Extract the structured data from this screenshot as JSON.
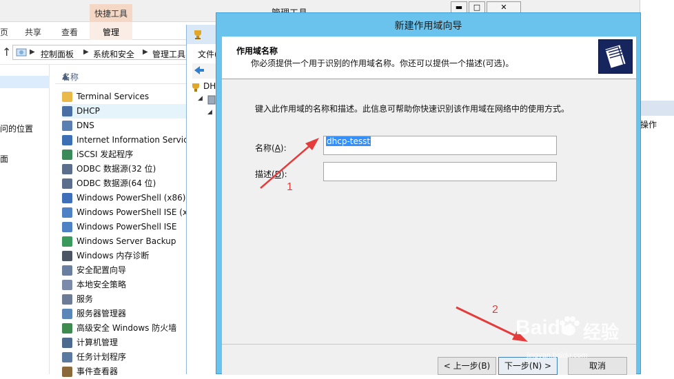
{
  "explorer": {
    "title": "管理工具",
    "context_tab_header": "快捷工具",
    "window_controls": [
      "▬",
      "□",
      "✕"
    ],
    "ribbon_tabs": [
      "页",
      "共享",
      "查看",
      "管理"
    ],
    "breadcrumb": [
      "控制面板",
      "系统和安全",
      "管理工具"
    ],
    "nav_items": [
      "问的位置",
      "面"
    ],
    "column_header": "名称",
    "items": [
      {
        "label": "Terminal Services",
        "icon": "folder-icon",
        "color": "#e9b94a"
      },
      {
        "label": "DHCP",
        "icon": "dhcp-icon",
        "color": "#4a6fa5",
        "selected": true
      },
      {
        "label": "DNS",
        "icon": "dns-icon",
        "color": "#5a7fb0"
      },
      {
        "label": "Internet Information Services",
        "icon": "iis-icon",
        "color": "#3c6fb3"
      },
      {
        "label": "iSCSI 发起程序",
        "icon": "iscsi-icon",
        "color": "#3a8a5a"
      },
      {
        "label": "ODBC 数据源(32 位)",
        "icon": "odbc-icon",
        "color": "#5b6f8c"
      },
      {
        "label": "ODBC 数据源(64 位)",
        "icon": "odbc-icon",
        "color": "#5b6f8c"
      },
      {
        "label": "Windows PowerShell (x86)",
        "icon": "powershell-icon",
        "color": "#3f6fb8"
      },
      {
        "label": "Windows PowerShell ISE (x",
        "icon": "powershell-ise-icon",
        "color": "#4f82c4"
      },
      {
        "label": "Windows PowerShell ISE",
        "icon": "powershell-ise-icon",
        "color": "#4f82c4"
      },
      {
        "label": "Windows Server Backup",
        "icon": "backup-icon",
        "color": "#3a9a5c"
      },
      {
        "label": "Windows 内存诊断",
        "icon": "memory-icon",
        "color": "#4b5563"
      },
      {
        "label": "安全配置向导",
        "icon": "security-wizard-icon",
        "color": "#6a7fa0"
      },
      {
        "label": "本地安全策略",
        "icon": "policy-icon",
        "color": "#7a8aa8"
      },
      {
        "label": "服务",
        "icon": "services-icon",
        "color": "#6c7c96"
      },
      {
        "label": "服务器管理器",
        "icon": "server-manager-icon",
        "color": "#5a86b8"
      },
      {
        "label": "高级安全 Windows 防火墙",
        "icon": "firewall-icon",
        "color": "#3f8a4f"
      },
      {
        "label": "计算机管理",
        "icon": "computer-management-icon",
        "color": "#4d6a8f"
      },
      {
        "label": "任务计划程序",
        "icon": "task-scheduler-icon",
        "color": "#5a7aa0"
      },
      {
        "label": "事件查看器",
        "icon": "event-viewer-icon",
        "color": "#8a6a3a"
      }
    ]
  },
  "mmc": {
    "menu_label": "文件(",
    "tree_root": "DH"
  },
  "right_window": {
    "text": "操作"
  },
  "wizard": {
    "title": "新建作用域向导",
    "header_title": "作用域名称",
    "header_subtitle": "你必须提供一个用于识别的作用域名称。你还可以提供一个描述(可选)。",
    "instruction": "键入此作用域的名称和描述。此信息可帮助你快速识别该作用域在网络中的使用方式。",
    "name_label_pre": "名称(",
    "name_label_key": "A",
    "name_label_post": "):",
    "name_value": "dhcp-tesst",
    "desc_label_pre": "描述(",
    "desc_label_key": "D",
    "desc_label_post": "):",
    "desc_value": "",
    "back_button": "< 上一步(B)",
    "next_button": "下一步(N) >",
    "cancel_button": "取消"
  },
  "annotations": {
    "arrow1_label": "1",
    "arrow2_label": "2",
    "arrow_color": "#e53b3b",
    "watermark_brand": "Baidu",
    "watermark_cn": "经验",
    "watermark_url": "jingyan.baidu.com"
  },
  "colors": {
    "wizard_frame": "#6ac3ec",
    "selection": "#3390ff",
    "context_tab": "#f5d7c6"
  }
}
